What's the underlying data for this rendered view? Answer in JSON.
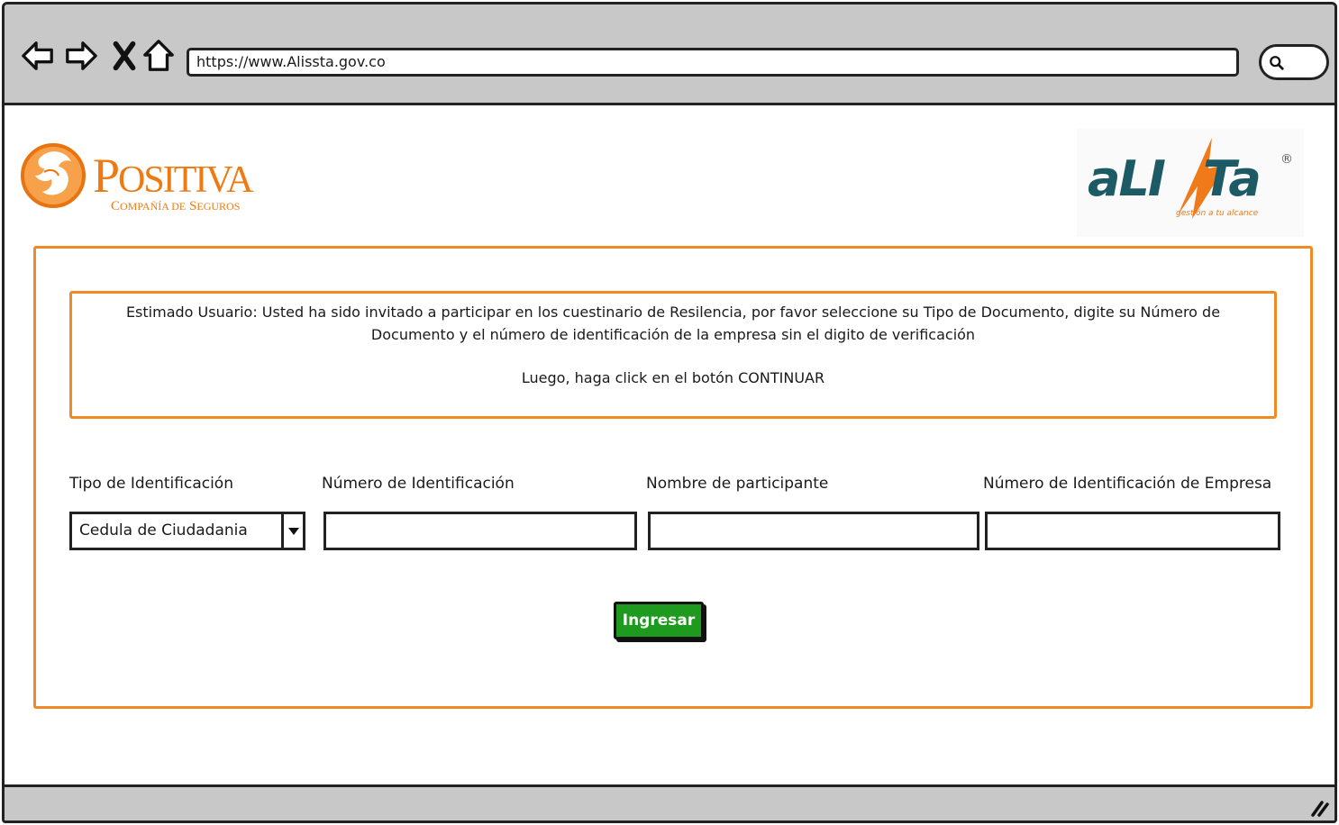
{
  "browser": {
    "url": "https://www.Alissta.gov.co",
    "icons": [
      "back-arrow-icon",
      "forward-arrow-icon",
      "close-x-icon",
      "home-icon",
      "search-icon",
      "resize-grip-icon"
    ]
  },
  "header": {
    "positiva_logo": {
      "name": "POSITIVA",
      "tagline": "COMPAÑÍA DE SEGUROS"
    },
    "alista_logo": {
      "name": "aLISTa",
      "tagline": "gestión a tu alcance",
      "registered": "®"
    }
  },
  "notice": {
    "text": "Estimado Usuario: Usted ha sido invitado a participar en los cuestinario de Resilencia, por favor seleccione su Tipo de Documento, digite su Número de Documento y el número de identificación de la empresa sin el digito de verificación",
    "text2": "Luego, haga click en el botón CONTINUAR"
  },
  "form": {
    "doc_type_label": "Tipo de Identificación",
    "doc_type_value": "Cedula de Ciudadania",
    "doc_number_label": "Número de Identificación",
    "participant_name_label": "Nombre de participante",
    "company_id_label": "Número de Identificación de Empresa",
    "submit_label": "Ingresar"
  },
  "colors": {
    "accent_orange": "#f08a24",
    "button_green": "#1e9a1e",
    "alista_teal": "#1c5a66",
    "chrome_gray": "#c8c8c8"
  }
}
